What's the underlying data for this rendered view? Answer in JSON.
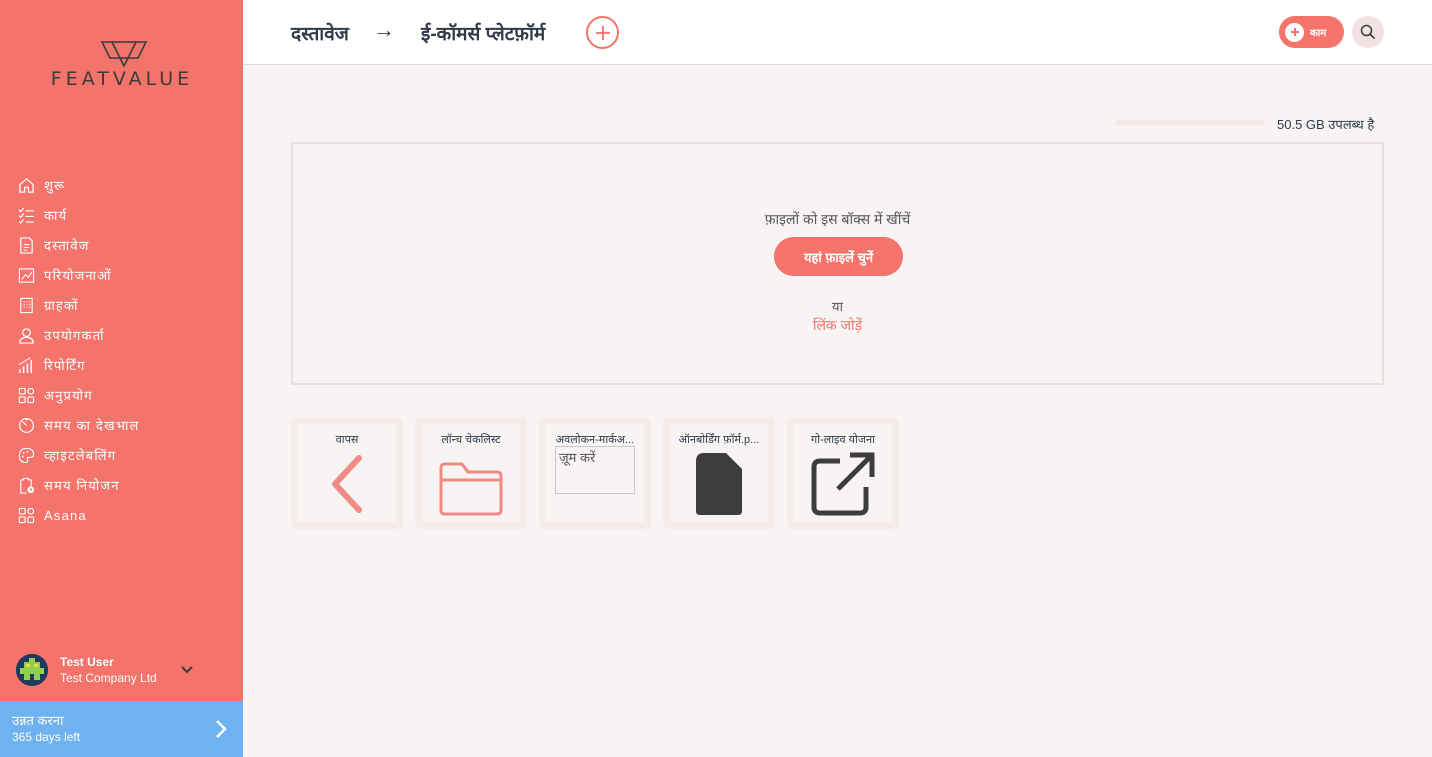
{
  "brand": {
    "name": "FEATVALUE",
    "accent": "#f4736b",
    "upgrade_color": "#6eb2f2"
  },
  "sidebar": {
    "items": [
      {
        "label": "शुरू",
        "icon": "home-icon"
      },
      {
        "label": "कार्य",
        "icon": "checklist-icon"
      },
      {
        "label": "दस्तावेज",
        "icon": "document-icon"
      },
      {
        "label": "परियोजनाओं",
        "icon": "chart-icon"
      },
      {
        "label": "ग्राहकों",
        "icon": "building-icon"
      },
      {
        "label": "उपयोगकर्ता",
        "icon": "user-icon"
      },
      {
        "label": "रिपोर्टिंग",
        "icon": "bar-chart-icon"
      },
      {
        "label": "अनुप्रयोग",
        "icon": "apps-icon"
      },
      {
        "label": "समय का देखभाल",
        "icon": "timer-icon"
      },
      {
        "label": "व्हाइटलेबलिंग",
        "icon": "palette-icon"
      },
      {
        "label": "समय नियोजन",
        "icon": "clipboard-clock-icon"
      },
      {
        "label": "Asana",
        "icon": "apps-icon"
      }
    ],
    "user": {
      "name": "Test User",
      "company": "Test Company Ltd"
    },
    "upgrade": {
      "title": "उन्नत करना",
      "subtitle": "365 days left"
    }
  },
  "header": {
    "breadcrumb_root": "दस्तावेज",
    "breadcrumb_arrow": "→",
    "breadcrumb_current": "ई-कॉमर्स प्लेटफ़ॉर्म",
    "task_button_label": "काम"
  },
  "storage": {
    "text": "50.5 GB उपलब्ध है"
  },
  "dropzone": {
    "hint": "फ़ाइलों को इस बॉक्स में खींचें",
    "choose_label": "यहां फ़ाइलें चुनें",
    "or_text": "या",
    "link_label": "लिंक जोड़ें"
  },
  "files": [
    {
      "label": "वापस",
      "icon": "chevron-left-icon"
    },
    {
      "label": "लॉन्च चेकलिस्ट",
      "icon": "folder-icon"
    },
    {
      "label": "अवलोकन-मार्कअ...",
      "icon": "image-icon",
      "alt": "ज़ूम करें"
    },
    {
      "label": "ऑनबोर्डिंग फ़ॉर्म.p...",
      "icon": "file-icon"
    },
    {
      "label": "गो-लाइव योजना",
      "icon": "external-link-icon"
    }
  ]
}
